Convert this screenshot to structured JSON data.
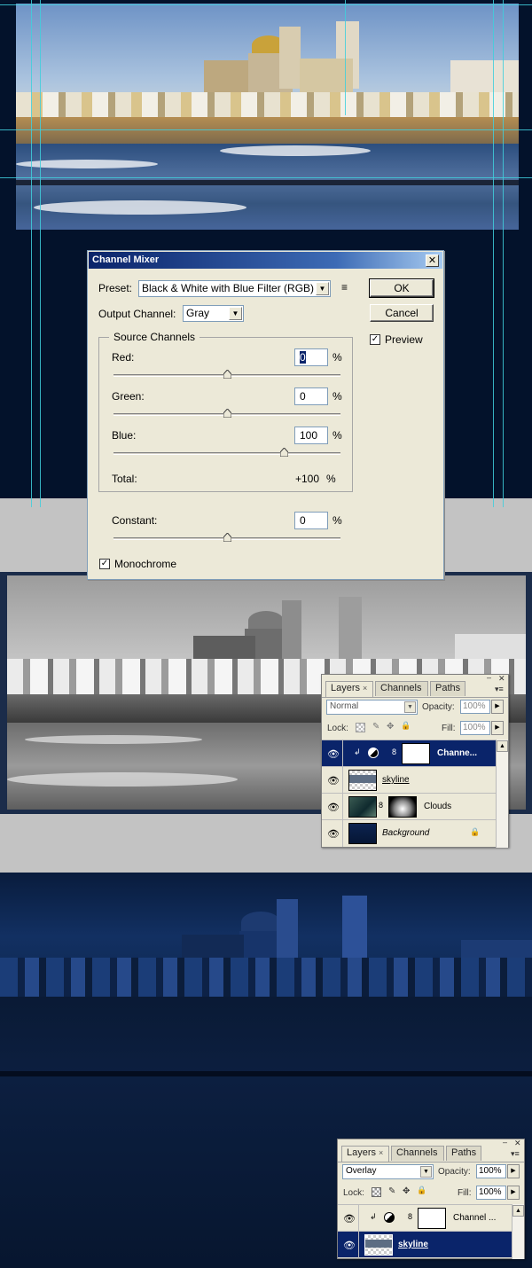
{
  "dialog": {
    "title": "Channel Mixer",
    "close_glyph": "✕",
    "preset_label": "Preset:",
    "preset_value": "Black & White with Blue Filter (RGB)",
    "output_channel_label": "Output Channel:",
    "output_channel_value": "Gray",
    "source_channels_label": "Source Channels",
    "ok_label": "OK",
    "cancel_label": "Cancel",
    "preview_label": "Preview",
    "preview_checked": true,
    "monochrome_label": "Monochrome",
    "monochrome_checked": true,
    "percent_sign": "%",
    "channels": [
      {
        "label": "Red:",
        "value": "0",
        "slider_fraction": 0.5
      },
      {
        "label": "Green:",
        "value": "0",
        "slider_fraction": 0.5
      },
      {
        "label": "Blue:",
        "value": "100",
        "slider_fraction": 0.75
      }
    ],
    "total_label": "Total:",
    "total_value": "+100",
    "constant_label": "Constant:",
    "constant_value": "0",
    "constant_slider_fraction": 0.5
  },
  "layers_panel_1": {
    "tabs": [
      "Layers",
      "Channels",
      "Paths"
    ],
    "blend_mode": "Normal",
    "opacity_label": "Opacity:",
    "opacity_value": "100%",
    "lock_label": "Lock:",
    "fill_label": "Fill:",
    "fill_value": "100%",
    "layers": [
      {
        "name": "Channe...",
        "selected": true
      },
      {
        "name": "skyline",
        "selected": false
      },
      {
        "name": "Clouds",
        "selected": false
      },
      {
        "name": "Background",
        "selected": false
      }
    ]
  },
  "layers_panel_2": {
    "tabs": [
      "Layers",
      "Channels",
      "Paths"
    ],
    "blend_mode": "Overlay",
    "opacity_label": "Opacity:",
    "opacity_value": "100%",
    "lock_label": "Lock:",
    "fill_label": "Fill:",
    "fill_value": "100%",
    "layers": [
      {
        "name": "Channel ...",
        "selected": false
      },
      {
        "name": "skyline",
        "selected": true
      }
    ]
  },
  "glyphs": {
    "eye": "👁",
    "tab_close": "×",
    "dropdown": "▼",
    "stepper": "▶",
    "panel_min": "–",
    "panel_close": "✕",
    "panel_menu": "▾≡",
    "checkmark": "✓",
    "lock": "🔒",
    "link": "8",
    "clip": "↲",
    "scroll_up": "▲",
    "preset_options": "≡"
  },
  "colors": {
    "dialog_bg": "#ece9d8",
    "title_start": "#0a246a",
    "title_end": "#a6caf0",
    "selected_row": "#0a246a",
    "guide": "#3fcfdc"
  }
}
